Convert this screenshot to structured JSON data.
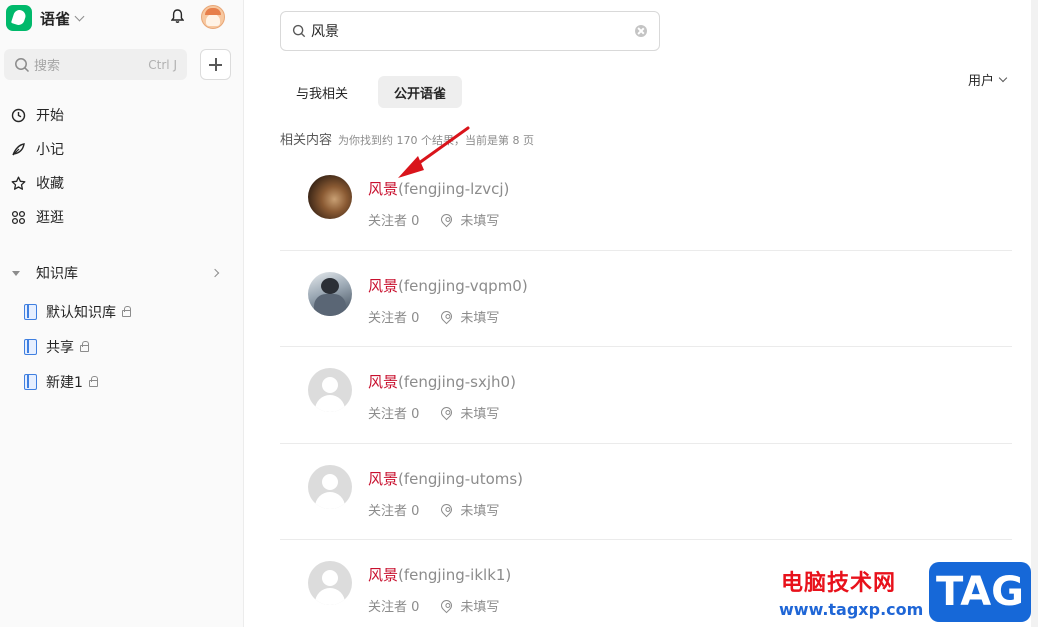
{
  "sidebar": {
    "app_name": "语雀",
    "search": {
      "placeholder": "搜索",
      "shortcut": "Ctrl J"
    },
    "nav": [
      {
        "label": "开始",
        "icon": "clock-icon"
      },
      {
        "label": "小记",
        "icon": "feather-icon"
      },
      {
        "label": "收藏",
        "icon": "star-icon"
      },
      {
        "label": "逛逛",
        "icon": "grid-icon"
      }
    ],
    "knowledge_base": {
      "title": "知识库",
      "items": [
        {
          "label": "默认知识库",
          "locked": true
        },
        {
          "label": "共享",
          "locked": true
        },
        {
          "label": "新建1",
          "locked": true
        }
      ]
    }
  },
  "main": {
    "search": {
      "value": "风景"
    },
    "tabs": [
      {
        "label": "与我相关",
        "active": false
      },
      {
        "label": "公开语雀",
        "active": true
      }
    ],
    "filter": {
      "label": "用户"
    },
    "summary": {
      "label": "相关内容",
      "info": "为你找到约 170 个结果，当前是第 8 页"
    },
    "results": [
      {
        "highlight": "风景",
        "handle": "(fengjing-lzvcj)",
        "followers": "关注者 0",
        "location": "未填写",
        "avatar": "photo1"
      },
      {
        "highlight": "风景",
        "handle": "(fengjing-vqpm0)",
        "followers": "关注者 0",
        "location": "未填写",
        "avatar": "photo2"
      },
      {
        "highlight": "风景",
        "handle": "(fengjing-sxjh0)",
        "followers": "关注者 0",
        "location": "未填写",
        "avatar": "default"
      },
      {
        "highlight": "风景",
        "handle": "(fengjing-utoms)",
        "followers": "关注者 0",
        "location": "未填写",
        "avatar": "default"
      },
      {
        "highlight": "风景",
        "handle": "(fengjing-iklk1)",
        "followers": "关注者 0",
        "location": "未填写",
        "avatar": "default"
      }
    ]
  },
  "watermark": {
    "site_name": "电脑技术网",
    "url": "www.tagxp.com",
    "tag": "TAG"
  },
  "colors": {
    "accent": "#00b96b",
    "highlight": "#c8102e",
    "annotation_arrow": "#d9141b",
    "watermark_blue": "#1668d8"
  }
}
